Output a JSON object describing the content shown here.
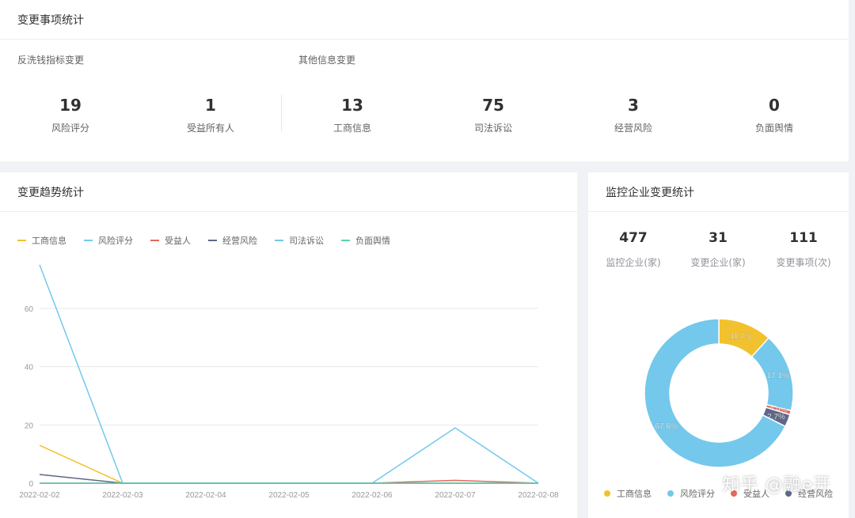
{
  "top": {
    "title": "变更事项统计",
    "group_aml": "反洗钱指标变更",
    "group_other": "其他信息变更",
    "stats": [
      {
        "value": "19",
        "label": "风险评分"
      },
      {
        "value": "1",
        "label": "受益所有人"
      },
      {
        "value": "13",
        "label": "工商信息"
      },
      {
        "value": "75",
        "label": "司法诉讼"
      },
      {
        "value": "3",
        "label": "经营风险"
      },
      {
        "value": "0",
        "label": "负面舆情"
      }
    ]
  },
  "trend": {
    "title": "变更趋势统计",
    "legend": [
      {
        "name": "工商信息",
        "color": "#f2c12e"
      },
      {
        "name": "风险评分",
        "color": "#73c8ec"
      },
      {
        "name": "受益人",
        "color": "#e8675a"
      },
      {
        "name": "经营风险",
        "color": "#5f6789"
      },
      {
        "name": "司法诉讼",
        "color": "#73c8ec"
      },
      {
        "name": "负面舆情",
        "color": "#5bd0a8"
      }
    ]
  },
  "monitor": {
    "title": "监控企业变更统计",
    "stats": [
      {
        "value": "477",
        "label": "监控企业(家)"
      },
      {
        "value": "31",
        "label": "变更企业(家)"
      },
      {
        "value": "111",
        "label": "变更事项(次)"
      }
    ],
    "legend": [
      {
        "name": "工商信息",
        "color": "#f2c12e"
      },
      {
        "name": "风险评分",
        "color": "#73c8ec"
      },
      {
        "name": "受益人",
        "color": "#e8675a"
      },
      {
        "name": "经营风险",
        "color": "#5f6789"
      }
    ]
  },
  "watermark": "知乎 @融e开",
  "chart_data": [
    {
      "type": "line",
      "categories": [
        "2022-02-02",
        "2022-02-03",
        "2022-02-04",
        "2022-02-05",
        "2022-02-06",
        "2022-02-07",
        "2022-02-08"
      ],
      "ylim": [
        0,
        60
      ],
      "yticks": [
        0,
        20,
        40,
        60
      ],
      "grid": true,
      "legend_position": "top-left",
      "series": [
        {
          "name": "工商信息",
          "color": "#f2c12e",
          "values": [
            13,
            0,
            0,
            0,
            0,
            0,
            0
          ]
        },
        {
          "name": "风险评分",
          "color": "#73c8ec",
          "values": [
            0,
            0,
            0,
            0,
            0,
            19,
            0
          ]
        },
        {
          "name": "受益人",
          "color": "#e8675a",
          "values": [
            0,
            0,
            0,
            0,
            0,
            1,
            0
          ]
        },
        {
          "name": "经营风险",
          "color": "#5f6789",
          "values": [
            3,
            0,
            0,
            0,
            0,
            0,
            0
          ]
        },
        {
          "name": "司法诉讼",
          "color": "#73c8ec",
          "values": [
            75,
            0,
            0,
            0,
            0,
            0,
            0
          ]
        },
        {
          "name": "负面舆情",
          "color": "#5bd0a8",
          "values": [
            0,
            0,
            0,
            0,
            0,
            0,
            0
          ]
        }
      ]
    },
    {
      "type": "pie",
      "donut": true,
      "slices": [
        {
          "name": "工商信息",
          "value": 11.7,
          "label": "11.7%",
          "color": "#f2c12e"
        },
        {
          "name": "风险评分",
          "value": 17.1,
          "label": "17.1%",
          "color": "#73c8ec"
        },
        {
          "name": "受益人",
          "value": 0.9,
          "label": "0.9%",
          "color": "#e8675a"
        },
        {
          "name": "经营风险",
          "value": 2.7,
          "label": "2.7%",
          "color": "#5f6789"
        },
        {
          "name": "司法诉讼",
          "value": 67.6,
          "label": "67.6%",
          "color": "#73c8ec"
        }
      ]
    }
  ]
}
